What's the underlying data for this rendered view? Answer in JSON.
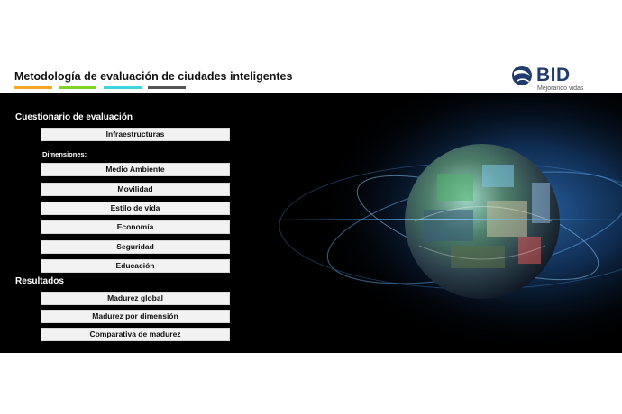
{
  "header": {
    "title": "Metodología de evaluación de ciudades inteligentes",
    "color_bars": [
      "#f5a623",
      "#7ed321",
      "#3dd6e0",
      "#555555"
    ],
    "logo": {
      "text": "BID",
      "tagline": "Mejorando vidas",
      "icon": "globe-swoosh-icon"
    }
  },
  "questionnaire": {
    "title": "Cuestionario de evaluación",
    "infra_button": "Infraestructuras",
    "dimensions_label": "Dimensiones:",
    "dimensions": [
      "Medio Ambiente",
      "Movilidad",
      "Estilo de vida",
      "Economía",
      "Seguridad",
      "Educación"
    ]
  },
  "results": {
    "title": "Resultados",
    "buttons": [
      "Madurez global",
      "Madurez por dimensión",
      "Comparativa de madurez"
    ]
  },
  "colors": {
    "panel_bg": "#000000",
    "button_bg": "#f2f2f2",
    "brand_blue": "#1f3c6b"
  },
  "visual": {
    "icon": "smart-city-globe-image"
  }
}
